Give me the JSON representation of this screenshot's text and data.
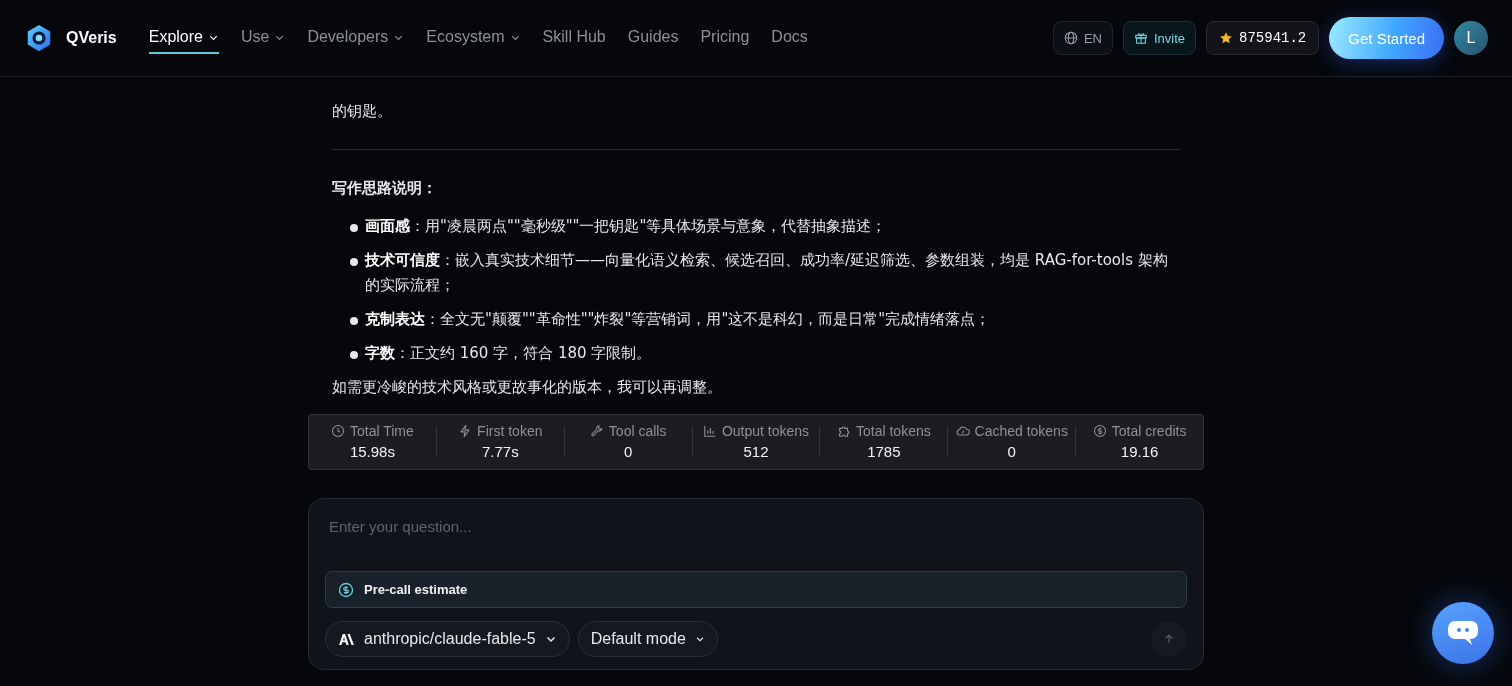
{
  "nav": {
    "brand": "QVeris",
    "items": [
      {
        "label": "Explore",
        "dropdown": true,
        "selected": true
      },
      {
        "label": "Use",
        "dropdown": true,
        "selected": false
      },
      {
        "label": "Developers",
        "dropdown": true,
        "selected": false
      },
      {
        "label": "Ecosystem",
        "dropdown": true,
        "selected": false
      },
      {
        "label": "Skill Hub",
        "dropdown": false,
        "selected": false
      },
      {
        "label": "Guides",
        "dropdown": false,
        "selected": false
      },
      {
        "label": "Pricing",
        "dropdown": false,
        "selected": false
      },
      {
        "label": "Docs",
        "dropdown": false,
        "selected": false
      }
    ],
    "language": "EN",
    "invite": "Invite",
    "credits": "875941.2",
    "cta": "Get Started",
    "avatar": "L"
  },
  "answer": {
    "paragraph": "的钥匙。",
    "heading": "写作思路说明：",
    "bullets": [
      "**画面感**：用\"凌晨两点\"\"毫秒级\"\"一把钥匙\"等具体场景与意象，代替抽象描述；",
      "**技术可信度**：嵌入真实技术细节——向量化语义检索、候选召回、成功率/延迟筛选、参数组装，均是 RAG-for-tools 架构的实际流程；",
      "**克制表达**：全文无\"颠覆\"\"革命性\"\"炸裂\"等营销词，用\"这不是科幻，而是日常\"完成情绪落点；",
      "**字数**：正文约 160 字，符合 180 字限制。"
    ],
    "closing": "如需更冷峻的技术风格或更故事化的版本，我可以再调整。"
  },
  "stats": [
    {
      "kind": "clock",
      "label": "Total Time",
      "value": "15.98s"
    },
    {
      "kind": "bolt",
      "label": "First token",
      "value": "7.77s"
    },
    {
      "kind": "wrench",
      "label": "Tool calls",
      "value": "0"
    },
    {
      "kind": "chart",
      "label": "Output tokens",
      "value": "512"
    },
    {
      "kind": "puzzle",
      "label": "Total tokens",
      "value": "1785"
    },
    {
      "kind": "cloud",
      "label": "Cached tokens",
      "value": "0"
    },
    {
      "kind": "dollar",
      "label": "Total credits",
      "value": "19.16"
    }
  ],
  "composer": {
    "placeholder": "Enter your question...",
    "estimate": "Pre-call estimate",
    "model": "anthropic/claude-fable-5",
    "mode": "Default mode"
  }
}
